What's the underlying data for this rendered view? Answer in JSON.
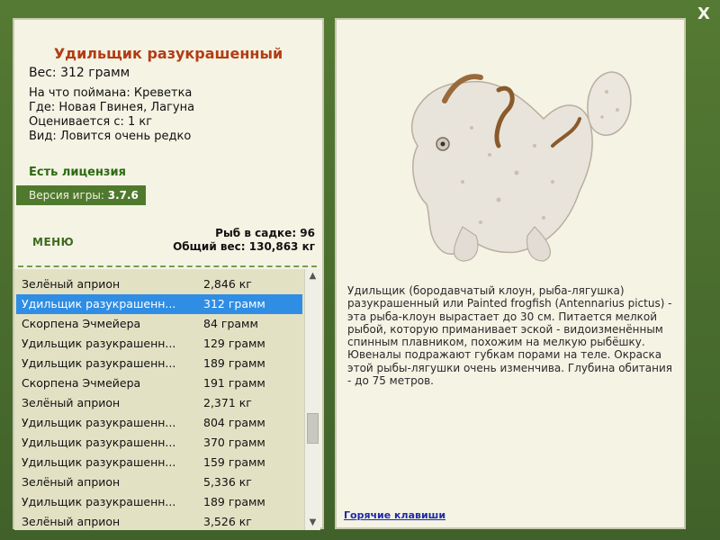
{
  "window": {
    "close_label": "X"
  },
  "fish": {
    "title": "Удильщик разукрашенный",
    "weight": "Вес: 312 грамм",
    "caught_on": "На что поймана: Креветка",
    "location": "Где: Новая Гвинея, Лагуна",
    "rated_from": "Оценивается с: 1 кг",
    "rarity": "Вид: Ловится очень редко"
  },
  "license": "Есть лицензия",
  "version": {
    "label": "Версия игры: ",
    "value": "3.7.6"
  },
  "menu_label": "МЕНЮ",
  "stats": {
    "fish_count": "Рыб в садке: 96",
    "total_weight": "Общий вес: 130,863 кг"
  },
  "catch_list": [
    {
      "name": "Зелёный априон",
      "weight": "2,846 кг",
      "selected": false
    },
    {
      "name": "Удильщик разукрашенн...",
      "weight": "312 грамм",
      "selected": true
    },
    {
      "name": "Скорпена Эчмейера",
      "weight": "84 грамм",
      "selected": false
    },
    {
      "name": "Удильщик разукрашенн...",
      "weight": "129 грамм",
      "selected": false
    },
    {
      "name": "Удильщик разукрашенн...",
      "weight": "189 грамм",
      "selected": false
    },
    {
      "name": "Скорпена Эчмейера",
      "weight": "191 грамм",
      "selected": false
    },
    {
      "name": "Зелёный априон",
      "weight": "2,371 кг",
      "selected": false
    },
    {
      "name": "Удильщик разукрашенн...",
      "weight": "804 грамм",
      "selected": false
    },
    {
      "name": "Удильщик разукрашенн...",
      "weight": "370 грамм",
      "selected": false
    },
    {
      "name": "Удильщик разукрашенн...",
      "weight": "159 грамм",
      "selected": false
    },
    {
      "name": "Зелёный априон",
      "weight": "5,336 кг",
      "selected": false
    },
    {
      "name": "Удильщик разукрашенн...",
      "weight": "189 грамм",
      "selected": false
    },
    {
      "name": "Зелёный априон",
      "weight": "3,526 кг",
      "selected": false
    }
  ],
  "description": "Удильщик (бородавчатый клоун, рыба-лягушка) разукрашенный или Painted frogfish (Antennarius pictus) - эта рыба-клоун вырастает до 30 см. Питается мелкой рыбой, которую приманивает эской - видоизменённым спинным плавником, похожим на мелкую рыбёшку. Ювеналы подражают губкам порами на теле. Окраска этой рыбы-лягушки очень изменчива. Глубина обитания - до 75 метров.",
  "hotkeys_label": "Горячие клавиши",
  "colors": {
    "frame_green": "#4f7a2e",
    "panel_bg": "#f4f3e4",
    "title_red": "#b33c14",
    "license_green": "#2d6a12",
    "selection_blue": "#2f8de4",
    "link_blue": "#1c2aa8"
  },
  "icons": {
    "close": "close-icon",
    "scroll_up": "chevron-up-icon",
    "scroll_down": "chevron-down-icon"
  }
}
